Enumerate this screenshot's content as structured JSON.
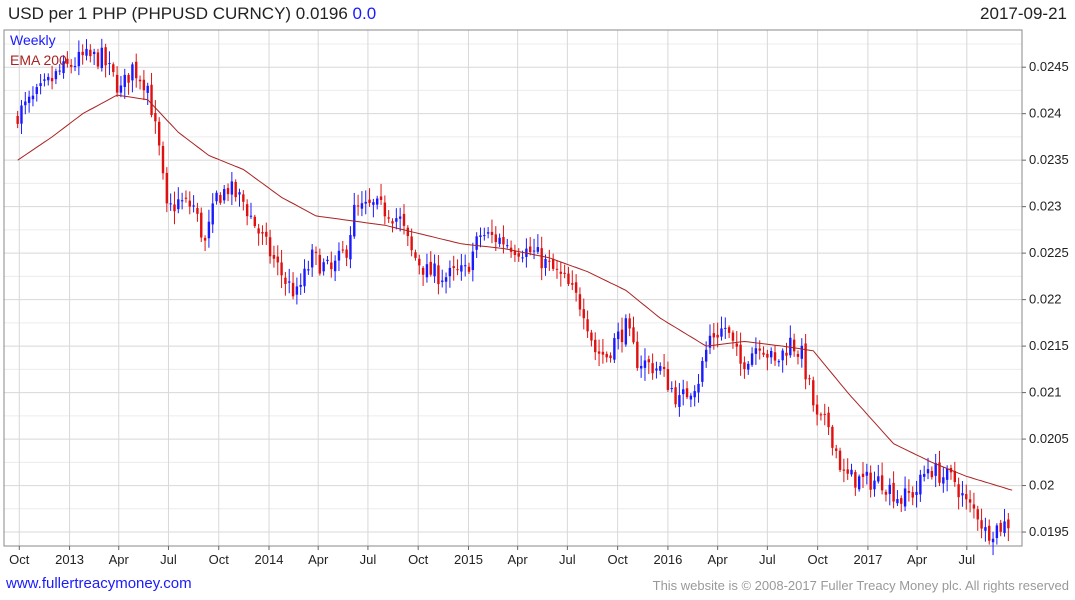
{
  "header": {
    "title": "USD per 1 PHP (PHPUSD CURNCY) 0.0196",
    "change": "0.0",
    "date": "2017-09-21"
  },
  "footer": {
    "website": "www.fullertreacymoney.com",
    "copyright": "This website is © 2008-2017 Fuller Treacy Money plc. All rights reserved"
  },
  "colors": {
    "up": "#1a1aff",
    "down": "#e01010",
    "ema": "#aa2222",
    "grid": "#d8d8d8"
  },
  "chart_data": {
    "type": "candlestick",
    "legend": [
      "Weekly",
      "EMA 200"
    ],
    "x_labels": [
      "Oct",
      "2013",
      "Apr",
      "Jul",
      "Oct",
      "2014",
      "Apr",
      "Jul",
      "Oct",
      "2015",
      "Apr",
      "Jul",
      "Oct",
      "2016",
      "Apr",
      "Jul",
      "Oct",
      "2017",
      "Apr",
      "Jul"
    ],
    "y_ticks": [
      "0.0195",
      "0.02",
      "0.0205",
      "0.021",
      "0.0215",
      "0.022",
      "0.0225",
      "0.023",
      "0.0235",
      "0.024",
      "0.0245"
    ],
    "ylim": [
      0.01935,
      0.0249
    ],
    "close_anchors": [
      [
        "2012-09-28",
        0.024
      ],
      [
        "2012-10-26",
        0.02415
      ],
      [
        "2012-12-14",
        0.02445
      ],
      [
        "2013-01-25",
        0.0246
      ],
      [
        "2013-03-01",
        0.0246
      ],
      [
        "2013-04-05",
        0.02425
      ],
      [
        "2013-04-26",
        0.0245
      ],
      [
        "2013-05-24",
        0.0243
      ],
      [
        "2013-06-14",
        0.0236
      ],
      [
        "2013-06-28",
        0.02295
      ],
      [
        "2013-07-19",
        0.02305
      ],
      [
        "2013-08-16",
        0.023
      ],
      [
        "2013-09-06",
        0.0226
      ],
      [
        "2013-09-27",
        0.0231
      ],
      [
        "2013-10-18",
        0.0232
      ],
      [
        "2013-11-15",
        0.02305
      ],
      [
        "2013-12-20",
        0.02265
      ],
      [
        "2014-01-31",
        0.0222
      ],
      [
        "2014-02-21",
        0.02205
      ],
      [
        "2014-03-21",
        0.02245
      ],
      [
        "2014-04-25",
        0.0223
      ],
      [
        "2014-05-23",
        0.02255
      ],
      [
        "2014-06-06",
        0.02295
      ],
      [
        "2014-07-11",
        0.023
      ],
      [
        "2014-08-08",
        0.02295
      ],
      [
        "2014-08-29",
        0.02285
      ],
      [
        "2014-09-19",
        0.0225
      ],
      [
        "2014-10-17",
        0.0223
      ],
      [
        "2014-11-21",
        0.02225
      ],
      [
        "2014-12-26",
        0.0223
      ],
      [
        "2015-01-23",
        0.0227
      ],
      [
        "2015-02-27",
        0.02265
      ],
      [
        "2015-04-03",
        0.02255
      ],
      [
        "2015-05-01",
        0.0225
      ],
      [
        "2015-05-29",
        0.02235
      ],
      [
        "2015-06-26",
        0.0222
      ],
      [
        "2015-07-31",
        0.0219
      ],
      [
        "2015-08-21",
        0.02145
      ],
      [
        "2015-09-11",
        0.0214
      ],
      [
        "2015-09-25",
        0.02155
      ],
      [
        "2015-10-16",
        0.0217
      ],
      [
        "2015-11-06",
        0.02135
      ],
      [
        "2015-12-18",
        0.02125
      ],
      [
        "2016-01-22",
        0.0209
      ],
      [
        "2016-02-26",
        0.02115
      ],
      [
        "2016-03-18",
        0.0216
      ],
      [
        "2016-04-15",
        0.0217
      ],
      [
        "2016-05-13",
        0.0213
      ],
      [
        "2016-06-17",
        0.02155
      ],
      [
        "2016-07-15",
        0.0213
      ],
      [
        "2016-08-12",
        0.02155
      ],
      [
        "2016-09-02",
        0.0214
      ],
      [
        "2016-09-30",
        0.0207
      ],
      [
        "2016-10-21",
        0.02065
      ],
      [
        "2016-11-18",
        0.0201
      ],
      [
        "2016-12-23",
        0.02005
      ],
      [
        "2017-01-27",
        0.02005
      ],
      [
        "2017-03-03",
        0.01985
      ],
      [
        "2017-03-31",
        0.01995
      ],
      [
        "2017-04-21",
        0.0202
      ],
      [
        "2017-05-19",
        0.0201
      ],
      [
        "2017-06-09",
        0.02005
      ],
      [
        "2017-06-30",
        0.0198
      ],
      [
        "2017-07-21",
        0.0197
      ],
      [
        "2017-08-04",
        0.0195
      ],
      [
        "2017-08-25",
        0.01955
      ],
      [
        "2017-09-15",
        0.0196
      ]
    ],
    "ema_anchors": [
      [
        "2012-09-28",
        0.0235
      ],
      [
        "2012-11-30",
        0.02375
      ],
      [
        "2013-01-25",
        0.024
      ],
      [
        "2013-03-29",
        0.0242
      ],
      [
        "2013-05-24",
        0.02415
      ],
      [
        "2013-07-19",
        0.0238
      ],
      [
        "2013-09-13",
        0.02355
      ],
      [
        "2013-11-15",
        0.0234
      ],
      [
        "2014-01-24",
        0.0231
      ],
      [
        "2014-03-28",
        0.0229
      ],
      [
        "2014-05-30",
        0.02285
      ],
      [
        "2014-08-01",
        0.0228
      ],
      [
        "2014-10-10",
        0.0227
      ],
      [
        "2014-12-19",
        0.0226
      ],
      [
        "2015-03-06",
        0.02255
      ],
      [
        "2015-05-29",
        0.02245
      ],
      [
        "2015-08-07",
        0.0223
      ],
      [
        "2015-10-16",
        0.0221
      ],
      [
        "2015-12-18",
        0.0218
      ],
      [
        "2016-03-11",
        0.0215
      ],
      [
        "2016-05-20",
        0.02155
      ],
      [
        "2016-07-29",
        0.0215
      ],
      [
        "2016-09-23",
        0.02145
      ],
      [
        "2016-11-25",
        0.021
      ],
      [
        "2017-02-17",
        0.02045
      ],
      [
        "2017-04-28",
        0.02025
      ],
      [
        "2017-06-30",
        0.0201
      ],
      [
        "2017-09-22",
        0.01995
      ]
    ]
  }
}
